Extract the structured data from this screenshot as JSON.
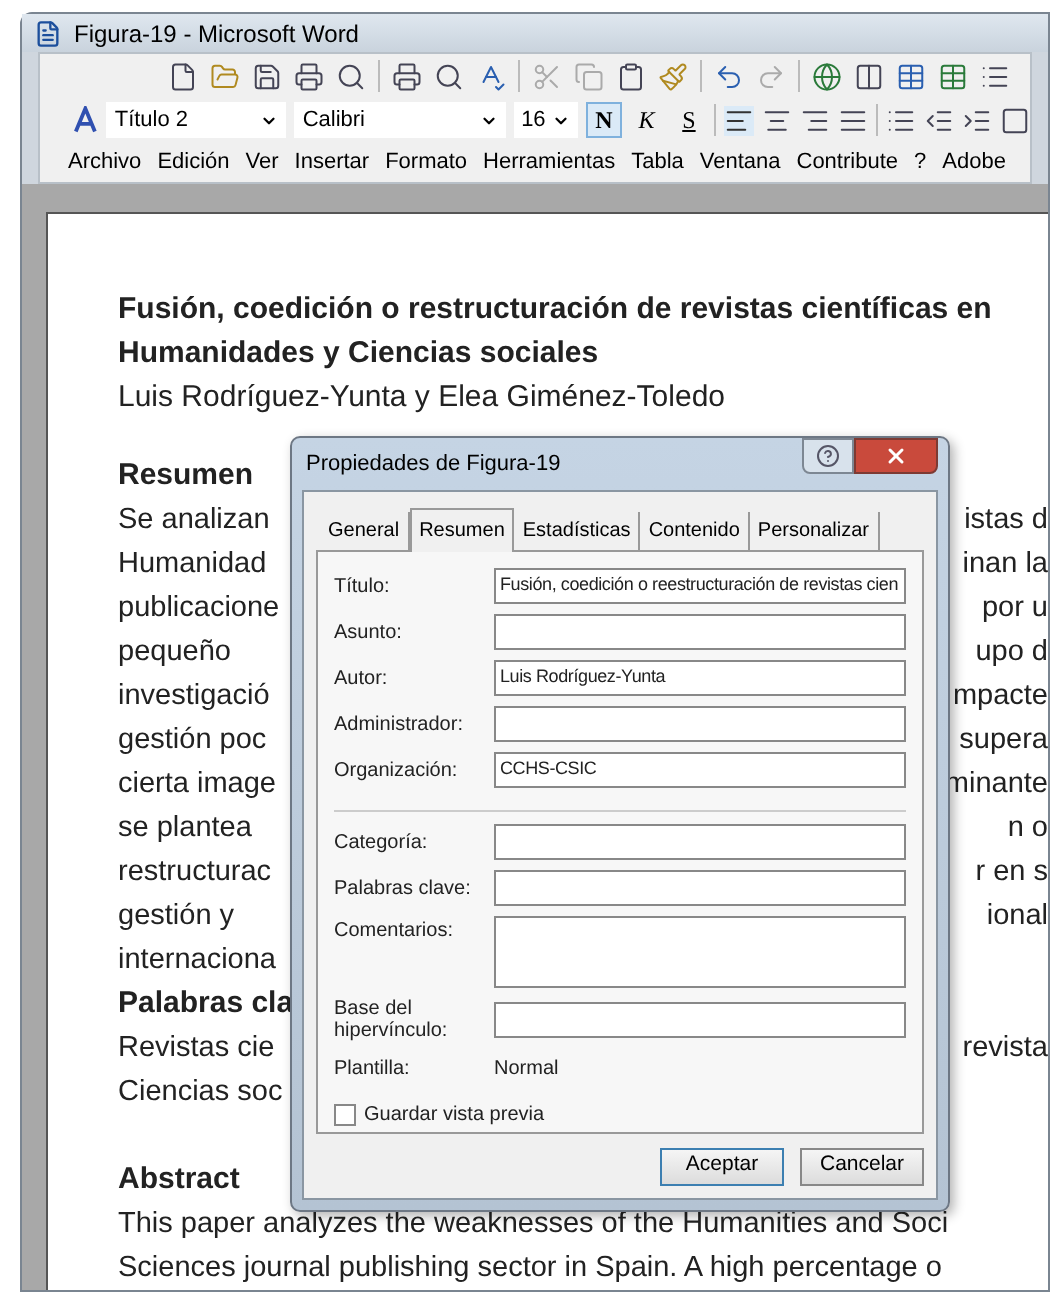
{
  "window": {
    "title": "Figura-19 - Microsoft Word"
  },
  "format_bar": {
    "style": "Título 2",
    "font": "Calibri",
    "size": "16",
    "buttons": [
      {
        "kind": "bold",
        "label": "N",
        "selected": true
      },
      {
        "kind": "italic",
        "label": "K",
        "selected": false
      },
      {
        "kind": "underline",
        "label": "S",
        "selected": false
      }
    ]
  },
  "menu": [
    "Archivo",
    "Edición",
    "Ver",
    "Insertar",
    "Formato",
    "Herramientas",
    "Tabla",
    "Ventana",
    "Contribute",
    "?",
    "Adobe"
  ],
  "document": {
    "title": "Fusión, coedición o restructuración de revistas científicas en Humanidades y Ciencias sociales",
    "authors": "Luis Rodríguez-Yunta y Elea Giménez-Toledo",
    "lines": [
      {
        "kind": "heading",
        "left": "Resumen"
      },
      {
        "kind": "text",
        "left": "Se analizan",
        "right": "istas d"
      },
      {
        "kind": "text",
        "left": "Humanidad",
        "right": "inan la"
      },
      {
        "kind": "text",
        "left": "publicacione",
        "right": "por u"
      },
      {
        "kind": "text",
        "left": "pequeño",
        "right": "upo d"
      },
      {
        "kind": "text",
        "left": "investigació",
        "right": "mpacte"
      },
      {
        "kind": "text",
        "left": "gestión poc",
        "right": "supera"
      },
      {
        "kind": "text",
        "left": "cierta image",
        "right": "minante"
      },
      {
        "kind": "text",
        "left": "se plantea",
        "right": "n o"
      },
      {
        "kind": "text",
        "left": "restructurac",
        "right": "r en s"
      },
      {
        "kind": "text",
        "left": "gestión y",
        "right": "ional"
      },
      {
        "kind": "text",
        "left": "internaciona"
      },
      {
        "kind": "heading",
        "left": "Palabras cla"
      },
      {
        "kind": "text",
        "left": "Revistas cie",
        "right": "revista"
      },
      {
        "kind": "text",
        "left": "Ciencias soc"
      },
      {
        "kind": "blank"
      },
      {
        "kind": "heading",
        "left": "Abstract"
      },
      {
        "kind": "text",
        "left": "This paper analyzes the weaknesses of the Humanities and Soci"
      },
      {
        "kind": "text",
        "left": "Sciences journal publishing sector in Spain. A high percentage o"
      }
    ]
  },
  "dialog": {
    "title": "Propiedades de Figura-19",
    "tabs": [
      {
        "label": "General",
        "selected": false
      },
      {
        "label": "Resumen",
        "selected": true
      },
      {
        "label": "Estadísticas",
        "selected": false
      },
      {
        "label": "Contenido",
        "selected": false
      },
      {
        "label": "Personalizar",
        "selected": false
      }
    ],
    "fields": [
      {
        "kind": "input",
        "label": "Título:",
        "value": "Fusión, coedición o reestructuración de revistas cien"
      },
      {
        "kind": "input",
        "label": "Asunto:"
      },
      {
        "kind": "input",
        "label": "Autor:",
        "value": "Luis Rodríguez-Yunta"
      },
      {
        "kind": "input",
        "label": "Administrador:"
      },
      {
        "kind": "input",
        "label": "Organización:",
        "value": "CCHS-CSIC"
      },
      {
        "kind": "separator"
      },
      {
        "kind": "input",
        "label": "Categoría:"
      },
      {
        "kind": "input",
        "label": "Palabras clave:"
      },
      {
        "kind": "textarea",
        "label": "Comentarios:"
      },
      {
        "kind": "input",
        "label": "Base del hipervínculo:"
      },
      {
        "kind": "static",
        "label": "Plantilla:",
        "value": "Normal"
      }
    ],
    "save_preview": {
      "label": "Guardar vista previa",
      "checked": false
    },
    "buttons": [
      "Aceptar",
      "Cancelar"
    ]
  }
}
